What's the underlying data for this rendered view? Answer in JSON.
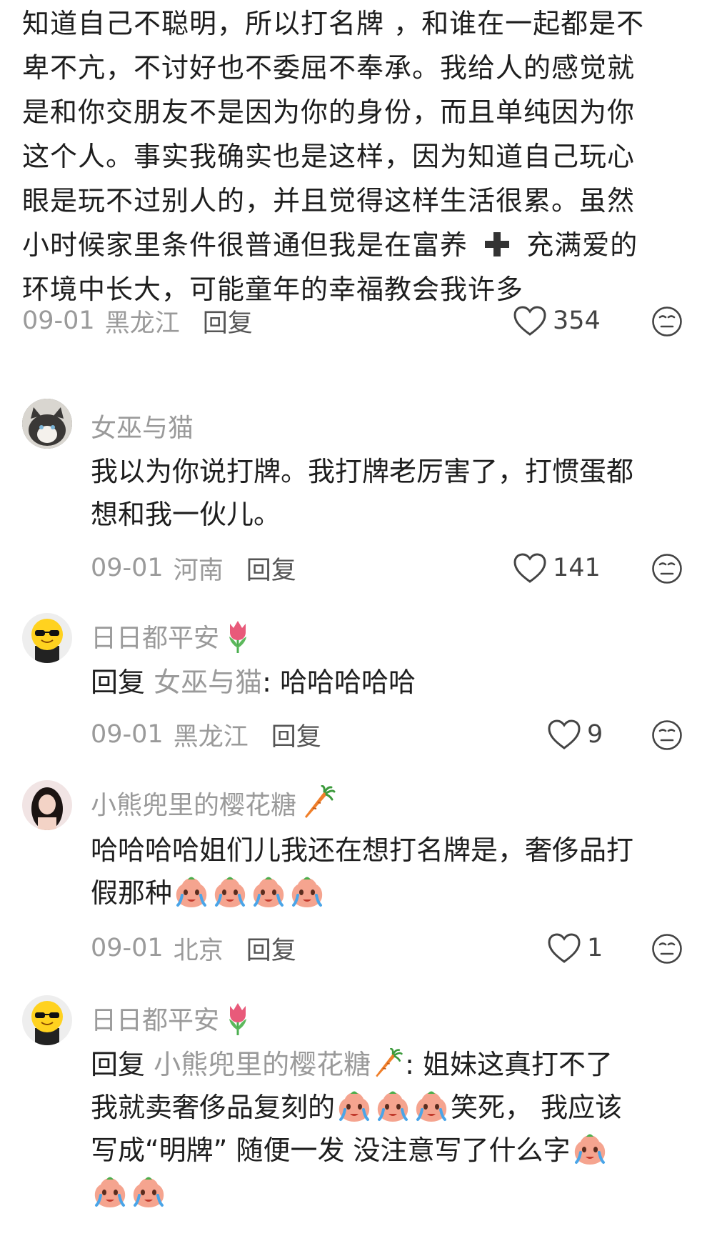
{
  "top_comment": {
    "lines": [
      "知道自己不聪明，所以打名牌 ，和谁在一起都是不",
      "卑不亢，不讨好也不委屈不奉承。我给人的感觉就",
      "是和你交朋友不是因为你的身份，而且单纯因为你",
      "这个人。事实我确实也是这样，因为知道自己玩心",
      "眼是玩不过别人的，并且觉得这样生活很累。虽然",
      "小时候家里条件很普通但我是在富养",
      "环境中长大，可能童年的幸福教会我许多"
    ],
    "line6_tail": "充满爱的",
    "date": "09-01",
    "location": "黑龙江",
    "reply_label": "回复",
    "likes": "354"
  },
  "replies": [
    {
      "username": "女巫与猫",
      "text_lines": [
        "我以为你说打牌。我打牌老厉害了，打惯蛋都",
        "想和我一伙儿。"
      ],
      "date": "09-01",
      "location": "河南",
      "reply_label": "回复",
      "likes": "141"
    },
    {
      "username": "日日都平安",
      "reply_prefix": "回复",
      "reply_to": "女巫与猫",
      "text": ": 哈哈哈哈哈",
      "date": "09-01",
      "location": "黑龙江",
      "reply_label": "回复",
      "likes": "9"
    },
    {
      "username": "小熊兜里的樱花糖",
      "text_lines": [
        "哈哈哈哈姐们儿我还在想打名牌是，奢侈品打",
        "假那种"
      ],
      "date": "09-01",
      "location": "北京",
      "reply_label": "回复",
      "likes": "1"
    },
    {
      "username": "日日都平安",
      "reply_prefix": "回复",
      "reply_to": "小熊兜里的樱花糖",
      "text_line1_tail": ": 姐妹这真打不了",
      "text_line2_head": "我就卖奢侈品复刻的",
      "text_line2_tail": "笑死， 我应该",
      "text_line3": "写成“明牌” 随便一发 没注意写了什么字"
    }
  ],
  "icons": {
    "heart": "heart-outline-icon",
    "reaction": "neutral-face-icon",
    "cross": "heavy-plus-emoji",
    "tulip": "tulip-emoji",
    "carrot": "carrot-emoji",
    "crying": "crying-peach-sticker"
  },
  "colors": {
    "text": "#1e1e1e",
    "meta": "#9a9a9a",
    "reply": "#555555",
    "tulip": "#e85a7a",
    "carrot": "#f07f2a"
  }
}
